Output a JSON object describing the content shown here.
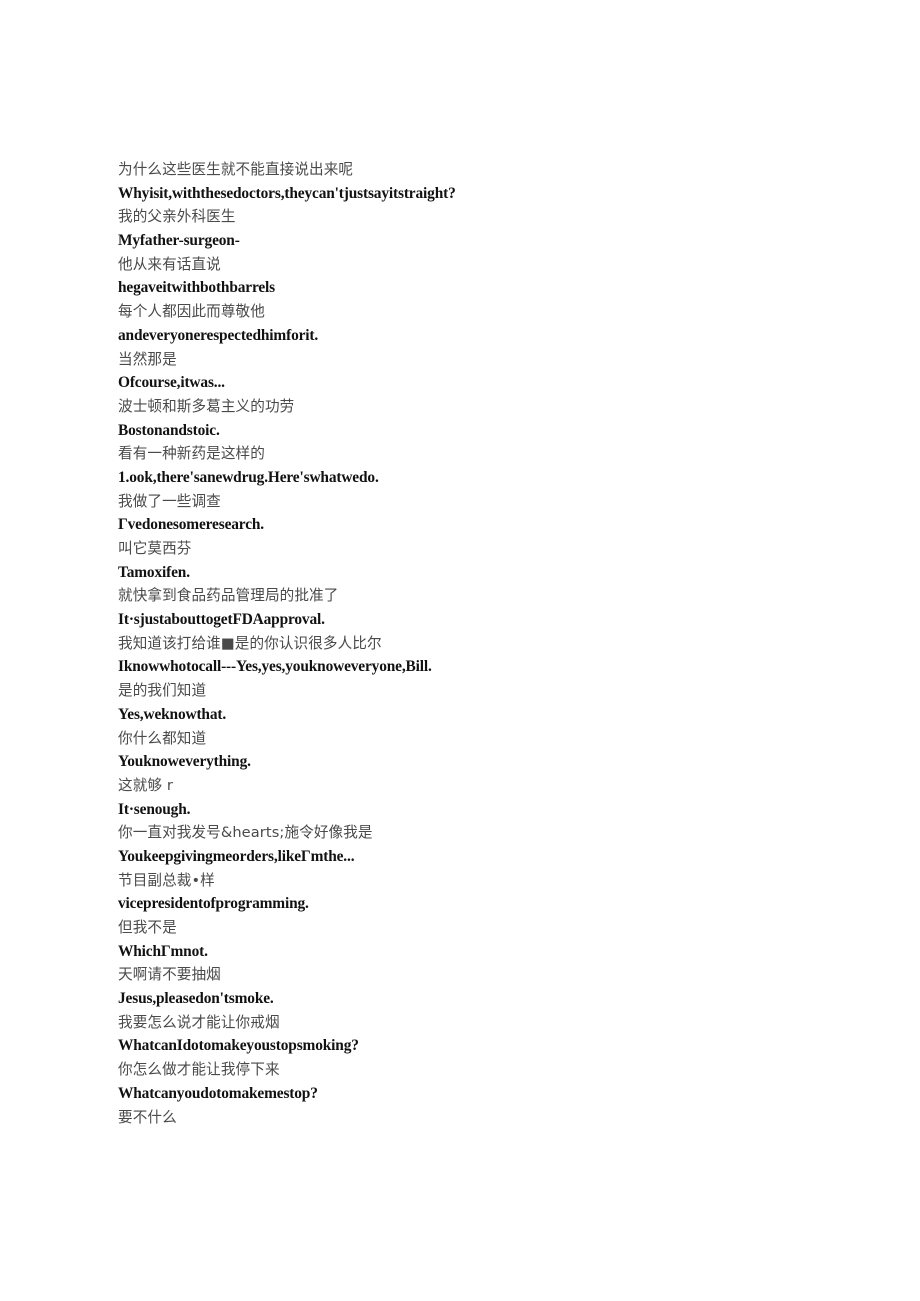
{
  "document": {
    "background_color": "#ffffff",
    "chinese_text_color": "#4a4a4a",
    "english_text_color": "#121212",
    "lines": [
      {
        "lang": "zh",
        "text": "为什么这些医生就不能直接说出来呢"
      },
      {
        "lang": "en",
        "text": "Whyisit,withthesedoctors,theycan'tjustsayitstraight?"
      },
      {
        "lang": "zh",
        "text": "我的父亲外科医生"
      },
      {
        "lang": "en",
        "text": "Myfather-surgeon-"
      },
      {
        "lang": "zh",
        "text": "他从来有话直说"
      },
      {
        "lang": "en",
        "text": "hegaveitwithbothbarrels"
      },
      {
        "lang": "zh",
        "text": "每个人都因此而尊敬他"
      },
      {
        "lang": "en",
        "text": "andeveryonerespectedhimforit."
      },
      {
        "lang": "zh",
        "text": "当然那是"
      },
      {
        "lang": "en",
        "text": "Ofcourse,itwas..."
      },
      {
        "lang": "zh",
        "text": "波士顿和斯多葛主义的功劳"
      },
      {
        "lang": "en",
        "text": "Bostonandstoic."
      },
      {
        "lang": "zh",
        "text": "看有一种新药是这样的"
      },
      {
        "lang": "en",
        "text": "1.ook,there'sanewdrug.Here'swhatwedo."
      },
      {
        "lang": "zh",
        "text": "我做了一些调查"
      },
      {
        "lang": "en",
        "text": "Γvedonesomeresearch."
      },
      {
        "lang": "zh",
        "text": "叫它莫西芬"
      },
      {
        "lang": "en",
        "text": "Tamoxifen."
      },
      {
        "lang": "zh",
        "text": "就快拿到食品药品管理局的批准了"
      },
      {
        "lang": "en",
        "text": "It·sjustabouttogetFDAapproval."
      },
      {
        "lang": "zh",
        "text": "我知道该打给谁■是的你认识很多人比尔"
      },
      {
        "lang": "en",
        "text": "Iknowwhotocall---Yes,yes,youknoweveryone,Bill."
      },
      {
        "lang": "zh",
        "text": "是的我们知道"
      },
      {
        "lang": "en",
        "text": "Yes,weknowthat."
      },
      {
        "lang": "zh",
        "text": "你什么都知道"
      },
      {
        "lang": "en",
        "text": "Youknoweverything."
      },
      {
        "lang": "zh",
        "text": "这就够 r"
      },
      {
        "lang": "en",
        "text": "It·senough."
      },
      {
        "lang": "zh",
        "text": "你一直对我发号&hearts;施令好像我是"
      },
      {
        "lang": "en",
        "text": "Youkeepgivingmeorders,likeΓmthe..."
      },
      {
        "lang": "zh",
        "text": "节目副总裁•样"
      },
      {
        "lang": "en",
        "text": "vicepresidentofprogramming."
      },
      {
        "lang": "zh",
        "text": "但我不是"
      },
      {
        "lang": "en",
        "text": "WhichΓmnot."
      },
      {
        "lang": "zh",
        "text": "天啊请不要抽烟"
      },
      {
        "lang": "en",
        "text": "Jesus,pleasedon'tsmoke."
      },
      {
        "lang": "zh",
        "text": "我要怎么说才能让你戒烟"
      },
      {
        "lang": "en",
        "text": "WhatcanIdotomakeyoustopsmoking?"
      },
      {
        "lang": "zh",
        "text": "你怎么做才能让我停下来"
      },
      {
        "lang": "en",
        "text": "Whatcanyoudotomakemestop?"
      },
      {
        "lang": "zh",
        "text": "要不什么"
      }
    ]
  }
}
